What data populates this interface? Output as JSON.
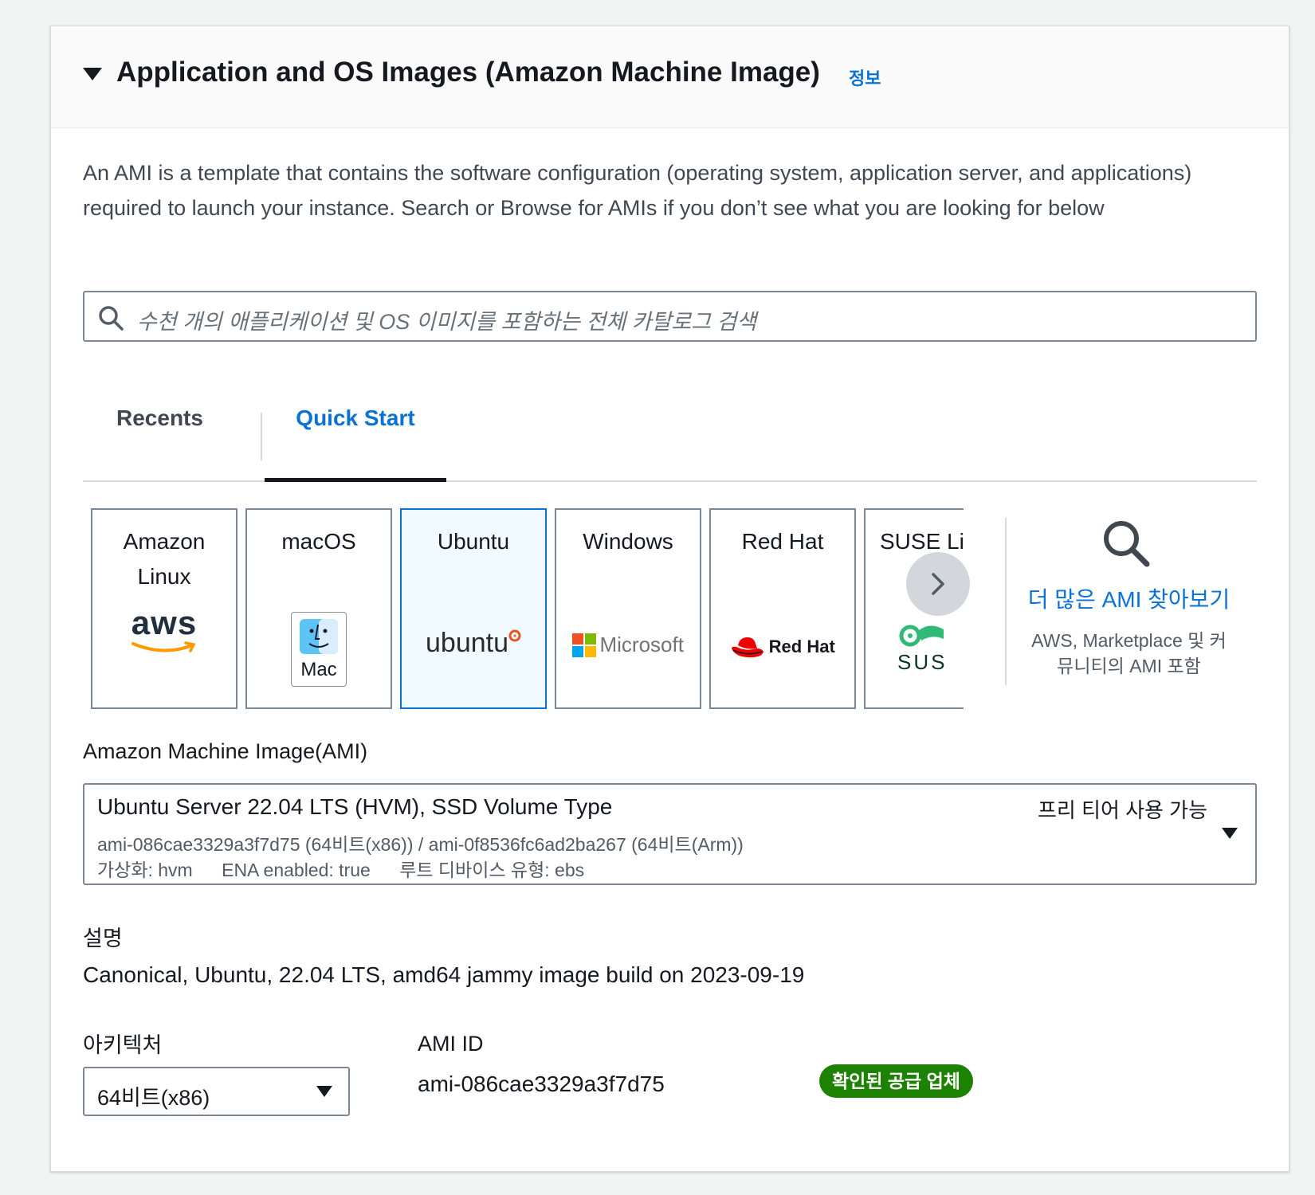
{
  "section": {
    "title": "Application and OS Images (Amazon Machine Image)",
    "info_link": "정보",
    "description": "An AMI is a template that contains the software configuration (operating system, application server, and applications) required to launch your instance. Search or Browse for AMIs if you don’t see what you are looking for below"
  },
  "search": {
    "placeholder": "수천 개의 애플리케이션 및 OS 이미지를 포함하는 전체 카탈로그 검색"
  },
  "tabs": {
    "recents": "Recents",
    "quick_start": "Quick Start",
    "active": "quick_start"
  },
  "os_tiles": [
    {
      "label": "Amazon Linux",
      "logo_text": "aws",
      "icon": "aws-logo-icon"
    },
    {
      "label": "macOS",
      "logo_text": "Mac",
      "icon": "mac-finder-icon"
    },
    {
      "label": "Ubuntu",
      "logo_text": "ubuntu",
      "icon": "ubuntu-logo-icon",
      "selected": true
    },
    {
      "label": "Windows",
      "logo_text": "Microsoft",
      "icon": "microsoft-logo-icon"
    },
    {
      "label": "Red Hat",
      "logo_text": "Red Hat",
      "icon": "redhat-logo-icon"
    },
    {
      "label": "SUSE Li",
      "logo_text": "SUS",
      "icon": "suse-logo-icon"
    }
  ],
  "browse": {
    "link": "더 많은 AMI 찾아보기",
    "subtext": "AWS, Marketplace 및 커뮤니티의 AMI 포함"
  },
  "ami": {
    "label": "Amazon Machine Image(AMI)",
    "name": "Ubuntu Server 22.04 LTS (HVM), SSD Volume Type",
    "ids": "ami-086cae3329a3f7d75 (64비트(x86)) / ami-0f8536fc6ad2ba267 (64비트(Arm))",
    "virtualization": "가상화: hvm",
    "ena": "ENA enabled: true",
    "root_device": "루트 디바이스 유형: ebs",
    "free_tier": "프리 티어 사용 가능"
  },
  "details": {
    "description_label": "설명",
    "description_value": "Canonical, Ubuntu, 22.04 LTS, amd64 jammy image build on 2023-09-19",
    "architecture_label": "아키텍처",
    "architecture_value": "64비트(x86)",
    "ami_id_label": "AMI ID",
    "ami_id_value": "ami-086cae3329a3f7d75",
    "verified_badge": "확인된 공급 업체"
  },
  "colors": {
    "link_blue": "#0972d3",
    "badge_green": "#1d8102",
    "selected_tile_bg": "#f1faff",
    "aws_orange": "#ff9900",
    "redhat_red": "#ee0000",
    "ubuntu_orange": "#e95420",
    "suse_green": "#30ba78"
  }
}
